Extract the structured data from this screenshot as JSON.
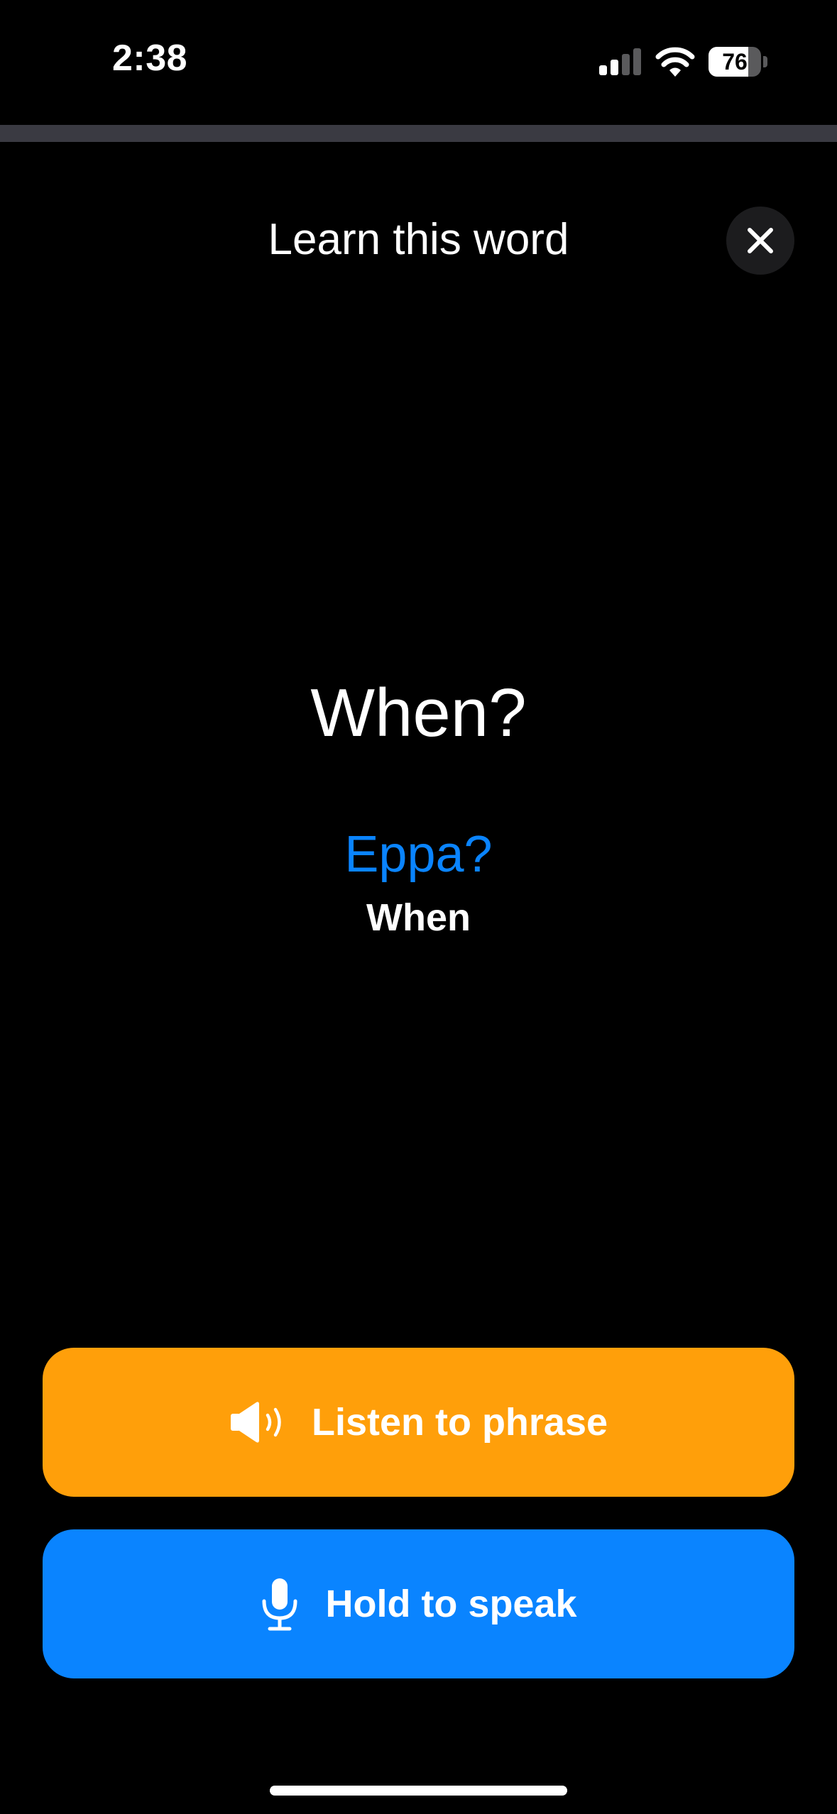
{
  "status_bar": {
    "time": "2:38",
    "battery_level": "76",
    "battery_fraction": 0.76,
    "signal_bars_active": 2,
    "signal_bars_total": 4
  },
  "lesson": {
    "progress_fraction": 0
  },
  "header": {
    "title": "Learn this word"
  },
  "word": {
    "prompt": "When?",
    "translation": "Eppa?",
    "gloss": "When"
  },
  "buttons": {
    "listen_label": "Listen to phrase",
    "speak_label": "Hold to speak"
  },
  "icons": {
    "close": "close-icon",
    "speaker": "speaker-wave-icon",
    "microphone": "microphone-icon",
    "signal": "cellular-signal-icon",
    "wifi": "wifi-icon",
    "battery": "battery-icon"
  },
  "colors": {
    "background": "#000000",
    "listen_button": "#ff9f0a",
    "speak_button": "#0a84ff",
    "translation_text": "#0a84ff",
    "close_button_bg": "#1c1c1e",
    "progress_track": "#3a3a42"
  }
}
